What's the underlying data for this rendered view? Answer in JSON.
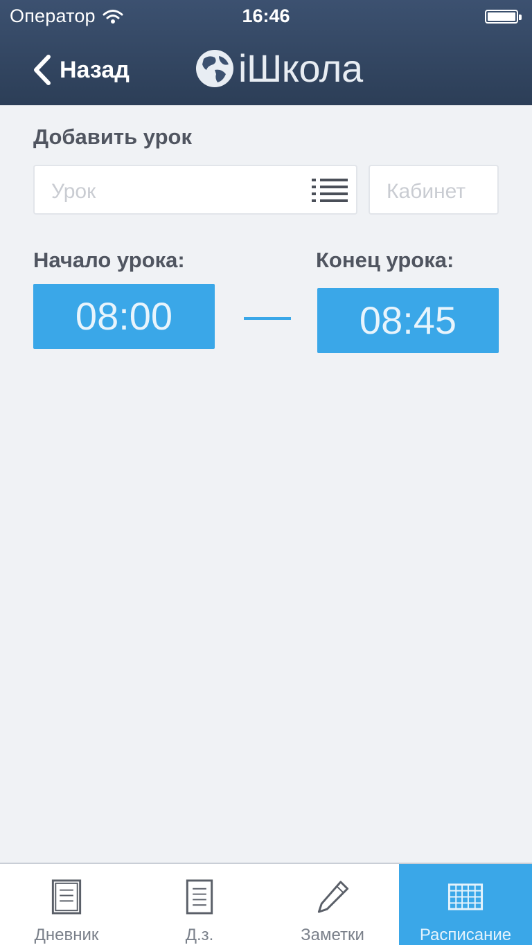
{
  "status_bar": {
    "carrier": "Оператор",
    "time": "16:46"
  },
  "nav": {
    "back_label": "Назад",
    "app_title": "iШкола"
  },
  "form": {
    "section_title": "Добавить урок",
    "lesson_placeholder": "Урок",
    "room_placeholder": "Кабинет",
    "start_label": "Начало урока:",
    "end_label": "Конец урока:",
    "start_time": "08:00",
    "end_time": "08:45"
  },
  "tabs": [
    {
      "label": "Дневник",
      "icon": "diary-icon",
      "active": false
    },
    {
      "label": "Д.з.",
      "icon": "homework-icon",
      "active": false
    },
    {
      "label": "Заметки",
      "icon": "pencil-icon",
      "active": false
    },
    {
      "label": "Расписание",
      "icon": "grid-icon",
      "active": true
    }
  ],
  "colors": {
    "header": "#2c3e57",
    "accent": "#3aa7e8",
    "background": "#f0f2f5"
  }
}
